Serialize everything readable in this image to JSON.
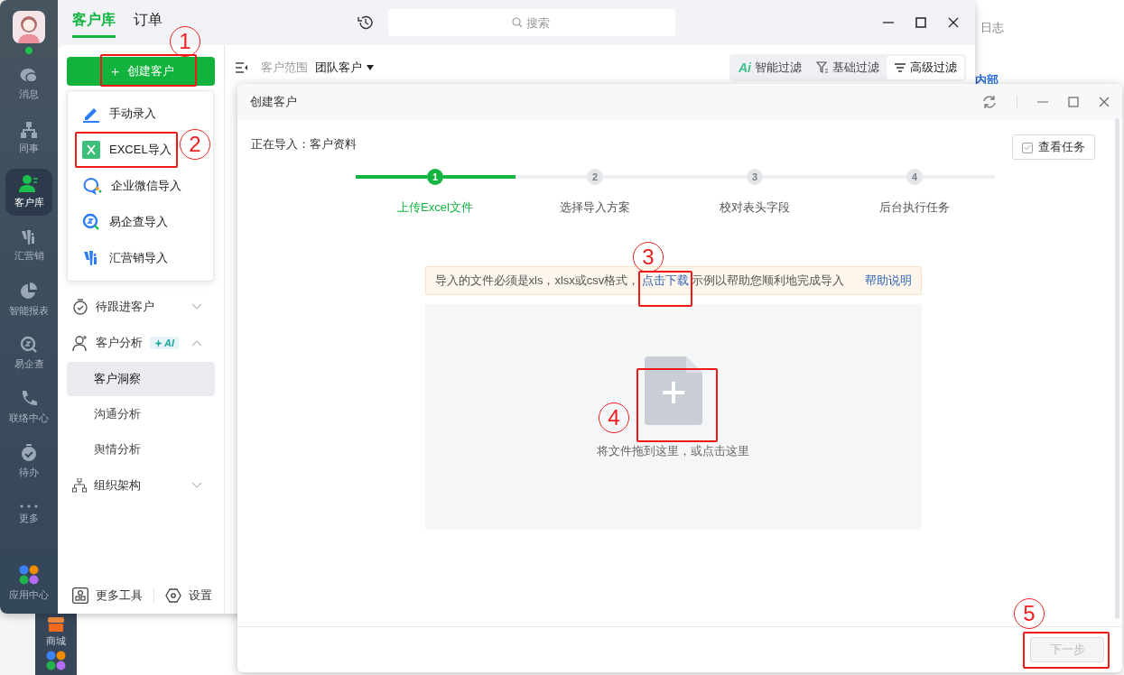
{
  "back_window": {
    "tab_partial": "日志",
    "heading_partial": "内部",
    "rail_items": [
      {
        "label": "商城",
        "kind": "shop"
      }
    ]
  },
  "nav_rail": {
    "online": true,
    "items": [
      {
        "label": "消息",
        "kind": "chat",
        "selected": false
      },
      {
        "label": "同事",
        "kind": "org",
        "selected": false
      },
      {
        "label": "客户库",
        "kind": "customer",
        "selected": true
      },
      {
        "label": "汇营销",
        "kind": "marketing",
        "selected": false
      },
      {
        "label": "智能报表",
        "kind": "pie",
        "selected": false
      },
      {
        "label": "易企查",
        "kind": "lookup",
        "selected": false
      },
      {
        "label": "联络中心",
        "kind": "phone",
        "selected": false
      },
      {
        "label": "待办",
        "kind": "todo",
        "selected": false
      },
      {
        "label": "更多",
        "kind": "more",
        "selected": false
      },
      {
        "label": "应用中心",
        "kind": "apps",
        "selected": false
      }
    ]
  },
  "panel": {
    "tabs": [
      {
        "label": "客户库",
        "selected": true
      },
      {
        "label": "订单",
        "selected": false
      }
    ],
    "create_button": {
      "icon": "＋",
      "label": "创建客户"
    },
    "create_menu": [
      {
        "label": "手动录入",
        "kind": "pen"
      },
      {
        "label": "EXCEL导入",
        "kind": "excel"
      },
      {
        "label": "企业微信导入",
        "kind": "wechat"
      },
      {
        "label": "易企查导入",
        "kind": "lookup"
      },
      {
        "label": "汇营销导入",
        "kind": "marketing"
      }
    ],
    "nav": [
      {
        "label": "待跟进客户",
        "kind": "timer",
        "expanded": false
      },
      {
        "label": "客户分析",
        "kind": "person",
        "badge": "AI",
        "expanded": true,
        "children": [
          {
            "label": "客户洞察",
            "selected": true
          },
          {
            "label": "沟通分析",
            "selected": false
          },
          {
            "label": "舆情分析",
            "selected": false
          }
        ]
      },
      {
        "label": "组织架构",
        "kind": "tree",
        "expanded": false
      }
    ],
    "footer": [
      {
        "label": "更多工具",
        "kind": "tools"
      },
      {
        "label": "设置",
        "kind": "settings"
      }
    ]
  },
  "top_bar": {
    "search": {
      "placeholder": "搜索"
    }
  },
  "toolbar": {
    "scope_label": "客户范围",
    "scope_value": "团队客户",
    "filters": [
      {
        "label": "智能过滤",
        "kind": "ai",
        "icon_text": "Ai",
        "selected": false
      },
      {
        "label": "基础过滤",
        "kind": "funnel",
        "selected": false
      },
      {
        "label": "高级过滤",
        "kind": "lines",
        "selected": true
      }
    ]
  },
  "dialog": {
    "title": "创建客户",
    "importing": "正在导入：客户资料",
    "tasks_button": "查看任务",
    "steps": [
      {
        "number": "1",
        "label": "上传Excel文件",
        "active": true
      },
      {
        "number": "2",
        "label": "选择导入方案",
        "active": false
      },
      {
        "number": "3",
        "label": "校对表头字段",
        "active": false
      },
      {
        "number": "4",
        "label": "后台执行任务",
        "active": false
      }
    ],
    "notice": {
      "text_before": "导入的文件必须是xls，xlsx或csv格式，",
      "link": "点击下载",
      "text_after": "示例以帮助您顺利地完成导入",
      "help": "帮助说明"
    },
    "drop_zone": {
      "text": "将文件拖到这里，或点击这里"
    },
    "next_button": {
      "label": "下一步",
      "disabled": true
    }
  },
  "annotations": [
    {
      "label": "1"
    },
    {
      "label": "2"
    },
    {
      "label": "3"
    },
    {
      "label": "4"
    },
    {
      "label": "5"
    }
  ]
}
